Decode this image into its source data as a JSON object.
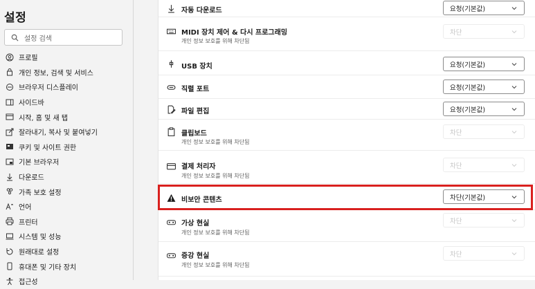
{
  "sidebar": {
    "title": "설정",
    "search_placeholder": "설정 검색",
    "items": [
      {
        "label": "프로필",
        "icon": "profile-icon"
      },
      {
        "label": "개인 정보, 검색 및 서비스",
        "icon": "lock-icon"
      },
      {
        "label": "브라우저 디스플레이",
        "icon": "display-icon"
      },
      {
        "label": "사이드바",
        "icon": "sidebar-icon"
      },
      {
        "label": "시작, 홈 및 새 탭",
        "icon": "home-tab-icon"
      },
      {
        "label": "잘라내기, 복사 및 붙여넣기",
        "icon": "share-icon"
      },
      {
        "label": "쿠키 및 사이트 권한",
        "icon": "cookie-icon"
      },
      {
        "label": "기본 브라우저",
        "icon": "browser-icon"
      },
      {
        "label": "다운로드",
        "icon": "download-icon"
      },
      {
        "label": "가족 보호 설정",
        "icon": "family-icon"
      },
      {
        "label": "언어",
        "icon": "language-icon"
      },
      {
        "label": "프린터",
        "icon": "printer-icon"
      },
      {
        "label": "시스템 및 성능",
        "icon": "system-icon"
      },
      {
        "label": "원래대로 설정",
        "icon": "reset-icon"
      },
      {
        "label": "휴대폰 및 기타 장치",
        "icon": "phone-icon"
      },
      {
        "label": "접근성",
        "icon": "accessibility-icon"
      }
    ]
  },
  "rows": [
    {
      "title": "자동 다운로드",
      "icon": "download-icon",
      "value": "요청(기본값)",
      "enabled": true
    },
    {
      "title": "MIDI 장치 제어 & 다시 프로그래밍",
      "sub": "개인 정보 보호를 위해 차단됨",
      "icon": "keyboard-icon",
      "value": "차단",
      "enabled": false
    },
    {
      "title": "USB 장치",
      "icon": "usb-icon",
      "value": "요청(기본값)",
      "enabled": true
    },
    {
      "title": "직렬 포트",
      "icon": "serial-port-icon",
      "value": "요청(기본값)",
      "enabled": true
    },
    {
      "title": "파일 편집",
      "icon": "file-edit-icon",
      "value": "요청(기본값)",
      "enabled": true
    },
    {
      "title": "클립보드",
      "sub": "개인 정보 보호를 위해 차단됨",
      "icon": "clipboard-icon",
      "value": "차단",
      "enabled": false
    },
    {
      "title": "결제 처리자",
      "sub": "개인 정보 보호를 위해 차단됨",
      "icon": "payment-icon",
      "value": "차단",
      "enabled": false
    },
    {
      "title": "비보안 콘텐츠",
      "icon": "warning-icon",
      "value": "차단(기본값)",
      "enabled": true
    },
    {
      "title": "가상 현실",
      "sub": "개인 정보 보호를 위해 차단됨",
      "icon": "vr-icon",
      "value": "차단",
      "enabled": false
    },
    {
      "title": "증강 현실",
      "sub": "개인 정보 보호를 위해 차단됨",
      "icon": "ar-icon",
      "value": "차단",
      "enabled": false
    }
  ],
  "colors": {
    "highlight": "#d9201e",
    "accent": "#1b1b1b"
  }
}
